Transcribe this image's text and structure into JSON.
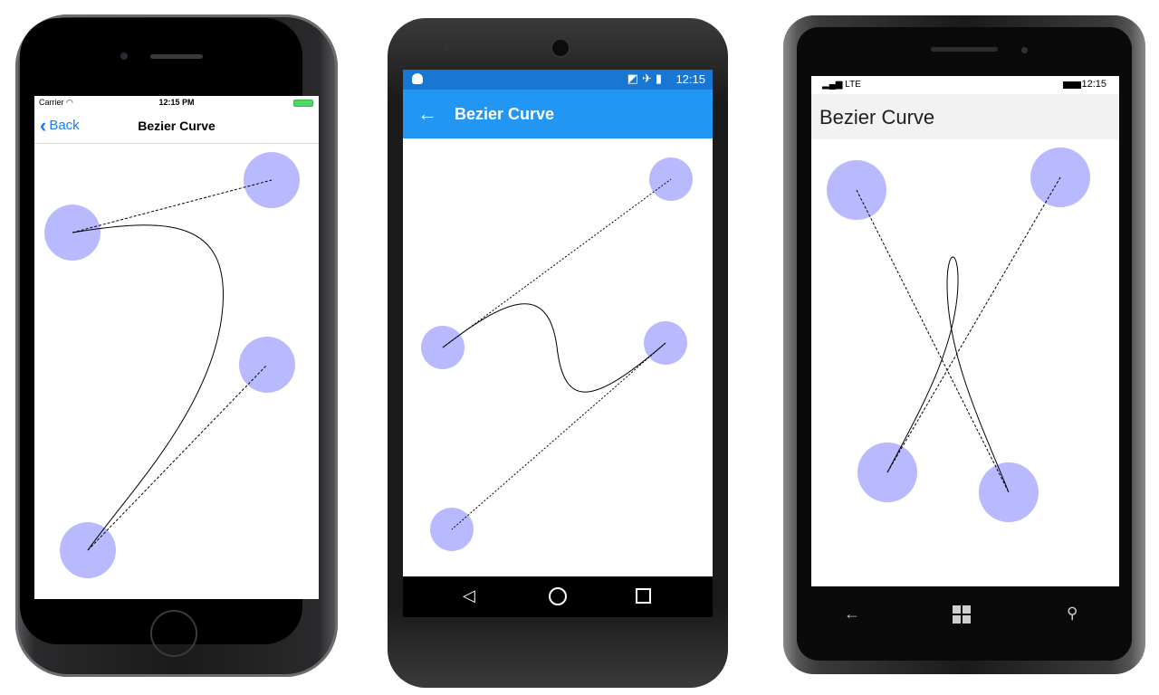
{
  "ios": {
    "carrier": "Carrier",
    "wifi_icon": "wifi-icon",
    "time": "12:15 PM",
    "back_label": "Back",
    "title": "Bezier Curve"
  },
  "android": {
    "time": "12:15",
    "status_icons": "◩✈▮",
    "back_arrow": "←",
    "title": "Bezier Curve",
    "nav_back": "◁"
  },
  "winphone": {
    "signal": "LTE",
    "time": "12:15",
    "title": "Bezier Curve",
    "nav_back": "←",
    "nav_search": "⚲"
  },
  "colors": {
    "handle_fill": "#b9b9ff",
    "ios_accent": "#1a7cf5",
    "android_appbar": "#2196f3",
    "android_status": "#1976d2"
  }
}
